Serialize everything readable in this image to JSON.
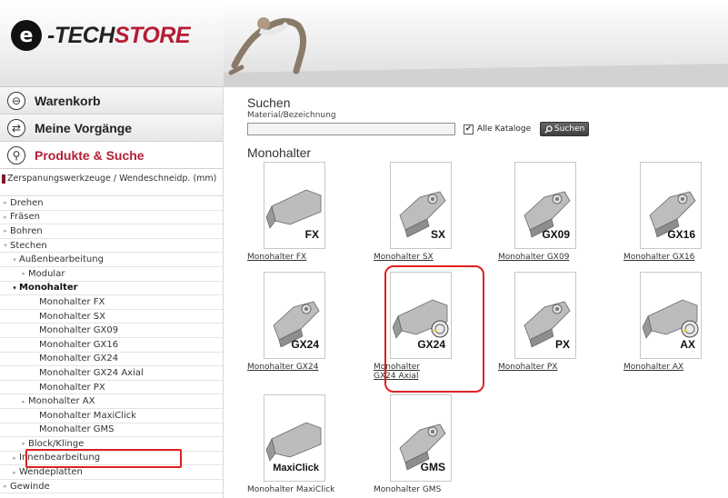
{
  "brand": {
    "logo_glyph": "e",
    "dash": "-",
    "tech": "TECH",
    "store": "STORE"
  },
  "sidebar": {
    "sections": [
      {
        "label": "Warenkorb",
        "icon": "basket-icon",
        "glyph": "⊖",
        "active": false
      },
      {
        "label": "Meine Vorgänge",
        "icon": "transfer-icon",
        "glyph": "⇄",
        "active": false
      },
      {
        "label": "Produkte & Suche",
        "icon": "search-icon",
        "glyph": "⚲",
        "active": true
      }
    ],
    "category": "Zerspanungswerkzeuge / Wendeschneidp. (mm)",
    "tree": [
      {
        "label": "Drehen",
        "level": 0,
        "arrow": "▸"
      },
      {
        "label": "Fräsen",
        "level": 0,
        "arrow": "▸"
      },
      {
        "label": "Bohren",
        "level": 0,
        "arrow": "▸"
      },
      {
        "label": "Stechen",
        "level": 0,
        "arrow": "▾"
      },
      {
        "label": "Außenbearbeitung",
        "level": 1,
        "arrow": "▾"
      },
      {
        "label": "Modular",
        "level": 2,
        "arrow": "▸"
      },
      {
        "label": "Monohalter",
        "level": 1,
        "arrow": "▾",
        "bold": true
      },
      {
        "label": "Monohalter FX",
        "level": 3,
        "arrow": ""
      },
      {
        "label": "Monohalter SX",
        "level": 3,
        "arrow": ""
      },
      {
        "label": "Monohalter GX09",
        "level": 3,
        "arrow": ""
      },
      {
        "label": "Monohalter GX16",
        "level": 3,
        "arrow": ""
      },
      {
        "label": "Monohalter GX24",
        "level": 3,
        "arrow": ""
      },
      {
        "label": "Monohalter GX24 Axial",
        "level": 3,
        "arrow": ""
      },
      {
        "label": "Monohalter PX",
        "level": 3,
        "arrow": ""
      },
      {
        "label": "Monohalter AX",
        "level": 2,
        "arrow": "▸"
      },
      {
        "label": "Monohalter MaxiClick",
        "level": 3,
        "arrow": ""
      },
      {
        "label": "Monohalter GMS",
        "level": 3,
        "arrow": ""
      },
      {
        "label": "Block/Klinge",
        "level": 2,
        "arrow": "▸"
      },
      {
        "label": "Innenbearbeitung",
        "level": 1,
        "arrow": "▸"
      },
      {
        "label": "Wendeplatten",
        "level": 1,
        "arrow": "▸"
      },
      {
        "label": "Gewinde",
        "level": 0,
        "arrow": "▸"
      }
    ]
  },
  "search": {
    "title": "Suchen",
    "field_label": "Material/Bezeichnung",
    "value": "",
    "all_catalogs_label": "Alle Kataloge",
    "all_catalogs_checked": "✔",
    "button_label": "Suchen",
    "button_icon": "search-icon"
  },
  "products": {
    "title": "Monohalter",
    "items": [
      {
        "code": "FX",
        "label": "Monohalter FX"
      },
      {
        "code": "SX",
        "label": "Monohalter SX"
      },
      {
        "code": "GX09",
        "label": "Monohalter GX09"
      },
      {
        "code": "GX16",
        "label": "Monohalter GX16"
      },
      {
        "code": "GX24",
        "label": "Monohalter GX24"
      },
      {
        "code": "GX24",
        "label": "Monohalter GX24 Axial"
      },
      {
        "code": "PX",
        "label": "Monohalter PX"
      },
      {
        "code": "AX",
        "label": "Monohalter AX"
      },
      {
        "code": "MaxiClick",
        "label": "Monohalter MaxiClick"
      },
      {
        "code": "GMS",
        "label": "Monohalter GMS"
      }
    ]
  }
}
